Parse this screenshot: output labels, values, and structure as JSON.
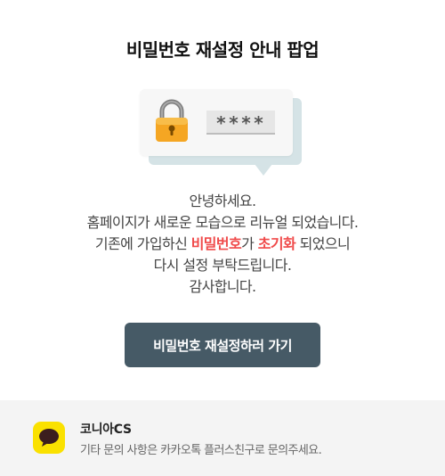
{
  "popup": {
    "title": "비밀번호 재설정 안내 팝업",
    "password_mask": "****",
    "message": {
      "line1": "안녕하세요.",
      "line2": "홈페이지가 새로운 모습으로 리뉴얼 되었습니다.",
      "line3_prefix": "기존에 가입하신 ",
      "line3_highlight1": "비밀번호",
      "line3_middle": "가 ",
      "line3_highlight2": "초기화",
      "line3_suffix": " 되었으니",
      "line4": "다시 설정 부탁드립니다.",
      "line5": "감사합니다."
    },
    "cta_label": "비밀번호 재설정하러 가기"
  },
  "footer": {
    "cs_name": "코니아CS",
    "cs_desc": "기타 문의 사항은 카카오톡 플러스친구로 문의주세요.",
    "icon": "kakao-chat-icon"
  },
  "colors": {
    "highlight": "#f04a4a",
    "button": "#465a66",
    "kakao": "#fae100",
    "lock_body": "#f5a623"
  }
}
